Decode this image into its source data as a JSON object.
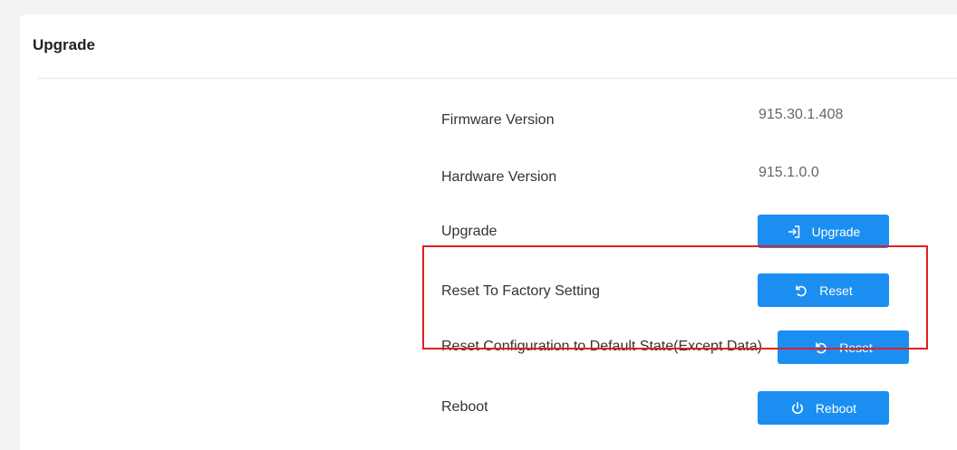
{
  "section": {
    "title": "Upgrade"
  },
  "rows": {
    "firmware": {
      "label": "Firmware Version",
      "value": "915.30.1.408"
    },
    "hardware": {
      "label": "Hardware Version",
      "value": "915.1.0.0"
    },
    "upgrade": {
      "label": "Upgrade",
      "button_label": "Upgrade",
      "icon": "upload-icon"
    },
    "factory_reset": {
      "label": "Reset To Factory Setting",
      "button_label": "Reset",
      "icon": "reset-icon"
    },
    "config_reset": {
      "label": "Reset Configuration to Default State(Except Data)",
      "button_label": "Reset",
      "icon": "reset-icon"
    },
    "reboot": {
      "label": "Reboot",
      "button_label": "Reboot",
      "icon": "power-icon"
    }
  },
  "colors": {
    "button": "#1b8ef2",
    "highlight": "#e02020",
    "background": "#f2f3f5"
  }
}
